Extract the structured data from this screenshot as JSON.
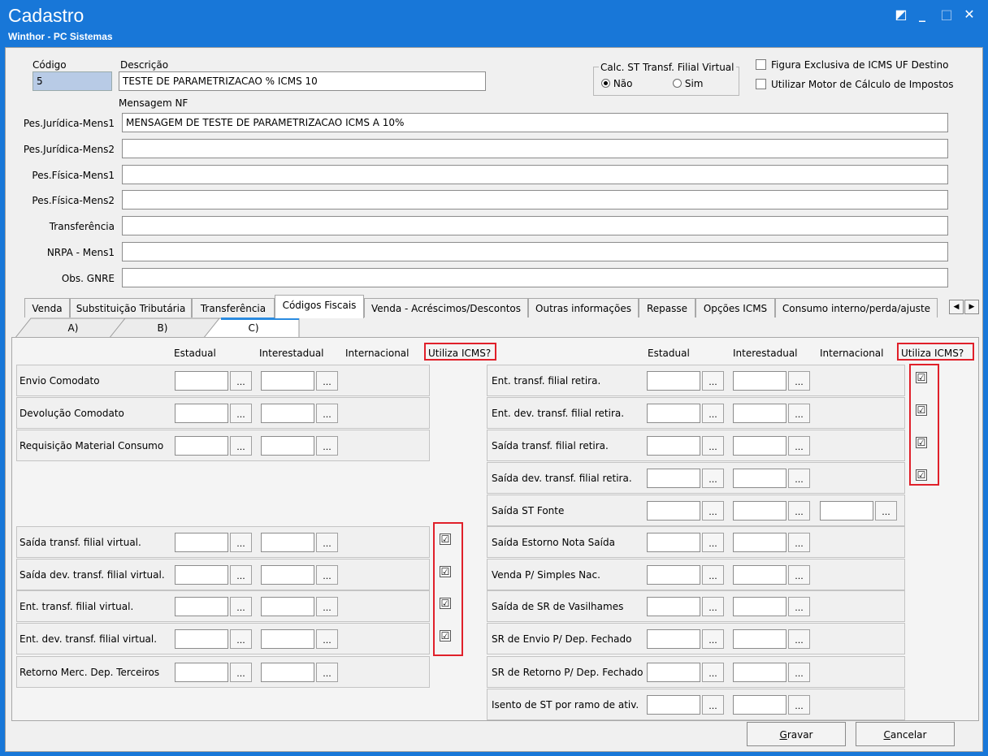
{
  "window": {
    "title": "Cadastro",
    "subtitle": "Winthor - PC Sistemas",
    "controls": [
      "◩",
      "_",
      "□",
      "✕"
    ]
  },
  "header": {
    "codigo_label": "Código",
    "codigo_value": "5",
    "descricao_label": "Descrição",
    "descricao_value": "TESTE DE PARAMETRIZACAO % ICMS 10",
    "calc_group_label": "Calc. ST Transf. Filial Virtual",
    "radio_nao": "Não",
    "radio_sim": "Sim",
    "figura_label": "Figura Exclusiva de ICMS UF Destino",
    "motor_label": "Utilizar Motor de Cálculo de Impostos",
    "mensagem_label": "Mensagem NF"
  },
  "messages": [
    {
      "label": "Pes.Jurídica-Mens1",
      "value": "MENSAGEM DE TESTE DE PARAMETRIZACAO ICMS A 10%"
    },
    {
      "label": "Pes.Jurídica-Mens2",
      "value": ""
    },
    {
      "label": "Pes.Física-Mens1",
      "value": ""
    },
    {
      "label": "Pes.Física-Mens2",
      "value": ""
    },
    {
      "label": "Transferência",
      "value": ""
    },
    {
      "label": "NRPA - Mens1",
      "value": ""
    },
    {
      "label": "Obs. GNRE",
      "value": ""
    }
  ],
  "tabs": [
    "Venda",
    "Substituição Tributária",
    "Transferência",
    "Códigos Fiscais",
    "Venda - Acréscimos/Descontos",
    "Outras informações",
    "Repasse",
    "Opções ICMS",
    "Consumo interno/perda/ajuste"
  ],
  "tab_scroll": [
    "◀",
    "▶"
  ],
  "subtabs": [
    "A)",
    "B)",
    "C)"
  ],
  "columns": {
    "estadual": "Estadual",
    "interestadual": "Interestadual",
    "internacional": "Internacional",
    "utiliza": "Utiliza ICMS?"
  },
  "dots": "...",
  "check": "☑",
  "left_rows": [
    "Envio Comodato",
    "Devolução Comodato",
    "Requisição Material Consumo",
    "Saída transf. filial virtual.",
    "Saída dev. transf. filial virtual.",
    "Ent. transf. filial virtual.",
    "Ent. dev. transf. filial virtual.",
    "Retorno Merc. Dep. Terceiros"
  ],
  "right_rows": [
    "Ent. transf. filial retira.",
    "Ent. dev. transf. filial retira.",
    "Saída transf. filial retira.",
    "Saída dev. transf. filial retira.",
    "Saída ST Fonte",
    "Saída Estorno Nota Saída",
    "Venda P/ Simples Nac.",
    "Saída de SR de Vasilhames",
    "SR de Envio P/ Dep. Fechado",
    "SR de Retorno P/ Dep. Fechado",
    "Isento de ST por ramo de ativ."
  ],
  "buttons": {
    "gravar_first": "G",
    "gravar_rest": "ravar",
    "cancelar_first": "C",
    "cancelar_rest": "ancelar"
  }
}
